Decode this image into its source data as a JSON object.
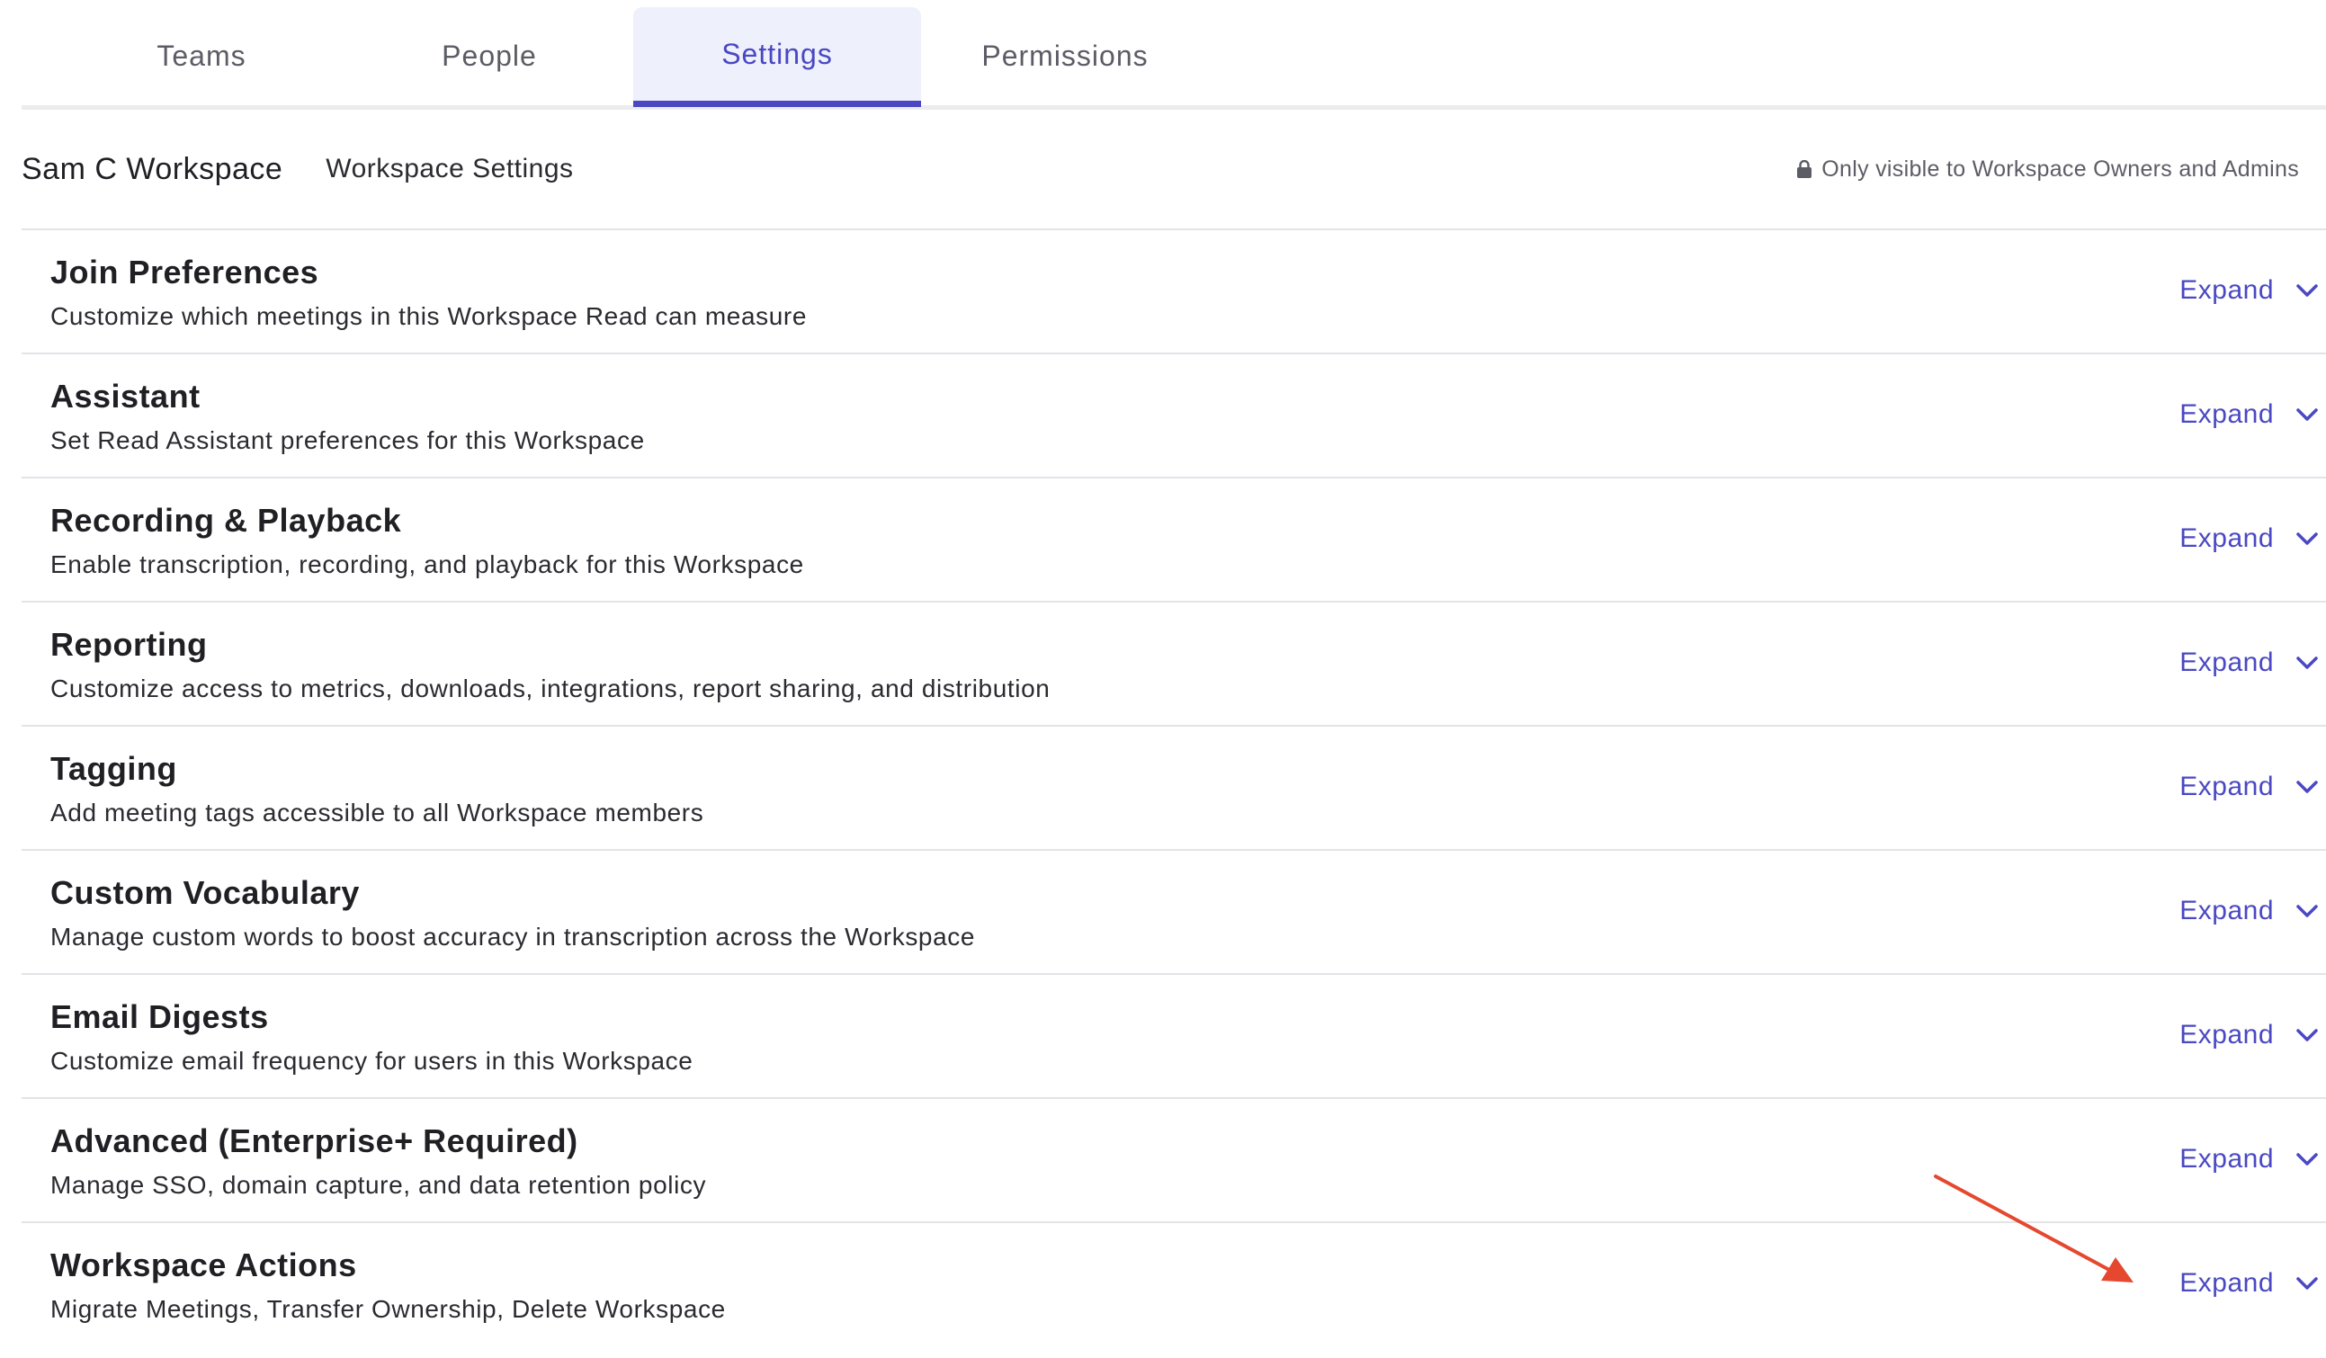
{
  "tabs": [
    {
      "label": "Teams"
    },
    {
      "label": "People"
    },
    {
      "label": "Settings"
    },
    {
      "label": "Permissions"
    }
  ],
  "header": {
    "workspace_name": "Sam C Workspace",
    "subtitle": "Workspace Settings",
    "visibility_note": "Only visible to Workspace Owners and Admins",
    "visibility_icon": "lock-icon"
  },
  "sections": [
    {
      "title": "Join Preferences",
      "description": "Customize which meetings in this Workspace Read can measure",
      "action": "Expand"
    },
    {
      "title": "Assistant",
      "description": "Set Read Assistant preferences for this Workspace",
      "action": "Expand"
    },
    {
      "title": "Recording & Playback",
      "description": "Enable transcription, recording, and playback for this Workspace",
      "action": "Expand"
    },
    {
      "title": "Reporting",
      "description": "Customize access to metrics, downloads, integrations, report sharing, and distribution",
      "action": "Expand"
    },
    {
      "title": "Tagging",
      "description": "Add meeting tags accessible to all Workspace members",
      "action": "Expand"
    },
    {
      "title": "Custom Vocabulary",
      "description": "Manage custom words to boost accuracy in transcription across the Workspace",
      "action": "Expand"
    },
    {
      "title": "Email Digests",
      "description": "Customize email frequency for users in this Workspace",
      "action": "Expand"
    },
    {
      "title": "Advanced (Enterprise+ Required)",
      "description": "Manage SSO, domain capture, and data retention policy",
      "action": "Expand"
    },
    {
      "title": "Workspace Actions",
      "description": "Migrate Meetings, Transfer Ownership, Delete Workspace",
      "action": "Expand"
    }
  ],
  "colors": {
    "accent": "#4a48c2",
    "active_tab_bg": "#eef0fb",
    "annotation_arrow": "#e5482f"
  }
}
